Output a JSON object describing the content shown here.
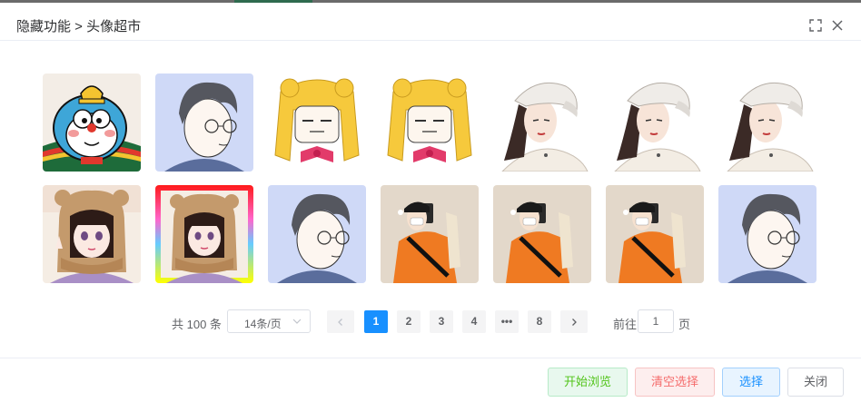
{
  "dialog": {
    "title": "隐藏功能 > 头像超市",
    "fullscreen_icon": "fullscreen-icon",
    "close_icon": "close-icon"
  },
  "avatars": [
    {
      "subject": "doraemon-cat-cartoon",
      "bg": "#f3ede6"
    },
    {
      "subject": "boy-glasses-illustration",
      "bg": "#cfd9f7"
    },
    {
      "subject": "sailor-moon-girl",
      "bg": "#ffffff"
    },
    {
      "subject": "sailor-moon-girl",
      "bg": "#ffffff"
    },
    {
      "subject": "girl-white-cap",
      "bg": "#ffffff"
    },
    {
      "subject": "girl-white-cap",
      "bg": "#ffffff"
    },
    {
      "subject": "girl-white-cap",
      "bg": "#ffffff"
    },
    {
      "subject": "girl-bear-hood",
      "bg": "#f5ede4"
    },
    {
      "subject": "girl-bear-hood-rainbow-frame",
      "bg": "#ff1a1a"
    },
    {
      "subject": "boy-glasses-illustration",
      "bg": "#cfd9f7"
    },
    {
      "subject": "boy-orange-sweater-selfie",
      "bg": "#e3d8ca"
    },
    {
      "subject": "boy-orange-sweater-selfie",
      "bg": "#e3d8ca"
    },
    {
      "subject": "boy-orange-sweater-selfie",
      "bg": "#e3d8ca"
    },
    {
      "subject": "boy-glasses-illustration",
      "bg": "#cfd9f7"
    }
  ],
  "pagination": {
    "total": "共 100 条",
    "page_size": "14条/页",
    "prev_icon": "chevron-left-icon",
    "next_icon": "chevron-right-icon",
    "pages": [
      "1",
      "2",
      "3",
      "4",
      "•••",
      "8"
    ],
    "current_page": "1",
    "goto_label": "前往",
    "goto_value": "1",
    "goto_suffix": "页"
  },
  "footer": {
    "browse_label": "开始浏览",
    "clear_label": "清空选择",
    "select_label": "选择",
    "close_label": "关闭"
  },
  "colors": {
    "primary": "#1890ff",
    "success": "#52c41a",
    "danger": "#f56c6c"
  }
}
